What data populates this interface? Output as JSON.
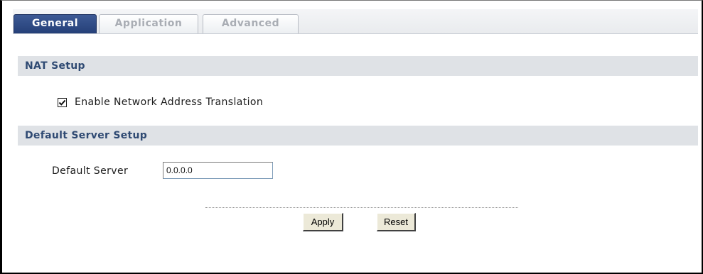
{
  "tabs": [
    {
      "label": "General",
      "active": true
    },
    {
      "label": "Application",
      "active": false
    },
    {
      "label": "Advanced",
      "active": false
    }
  ],
  "nat_setup": {
    "title": "NAT Setup",
    "enable_nat": {
      "label": "Enable Network Address Translation",
      "checked": true
    }
  },
  "default_server_setup": {
    "title": "Default Server Setup",
    "default_server": {
      "label": "Default Server",
      "value": "0.0.0.0"
    }
  },
  "actions": {
    "apply_label": "Apply",
    "reset_label": "Reset"
  },
  "colors": {
    "active_tab": "#2c4a85",
    "section_header_bg": "#dfe2e6",
    "section_header_text": "#2f4a73"
  },
  "icons": {
    "checkbox": "checkmark-icon"
  }
}
